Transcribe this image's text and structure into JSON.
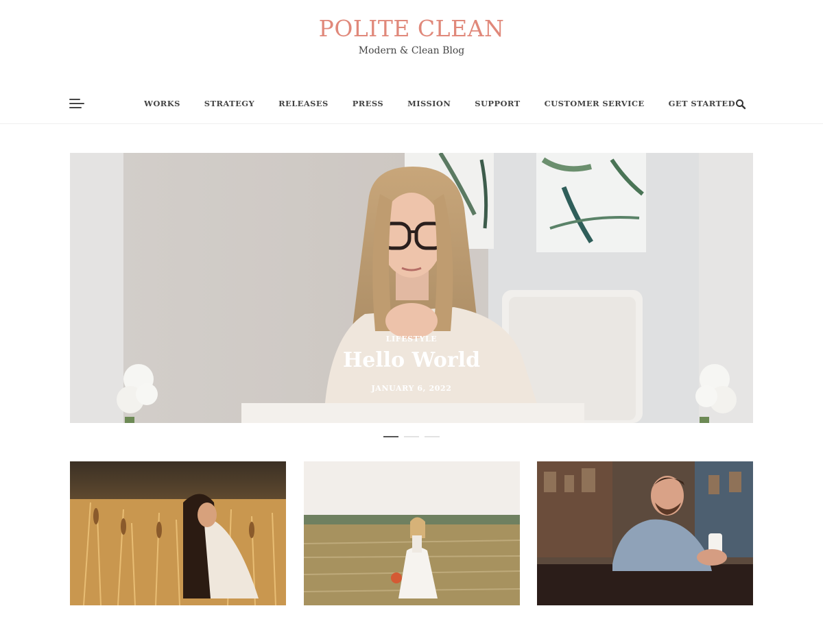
{
  "header": {
    "site_title": "POLITE CLEAN",
    "tagline": "Modern & Clean Blog"
  },
  "nav": {
    "menu_icon": "hamburger-menu-icon",
    "items": [
      {
        "label": "WORKS"
      },
      {
        "label": "STRATEGY"
      },
      {
        "label": "RELEASES"
      },
      {
        "label": "PRESS"
      },
      {
        "label": "MISSION"
      },
      {
        "label": "SUPPORT"
      },
      {
        "label": "CUSTOMER SERVICE"
      },
      {
        "label": "GET STARTED"
      }
    ],
    "search_icon": "search-icon"
  },
  "hero": {
    "category": "LIFESTYLE",
    "title": "Hello World",
    "date": "JANUARY 6, 2022",
    "slide_count": 3,
    "active_slide": 1
  },
  "cards": [
    {
      "image": "woman in golden wheat field"
    },
    {
      "image": "woman in white dress in hay field"
    },
    {
      "image": "smiling man holding coffee cup"
    }
  ],
  "colors": {
    "brand": "#e0887a",
    "text": "#444444",
    "divider": "#efefef"
  }
}
